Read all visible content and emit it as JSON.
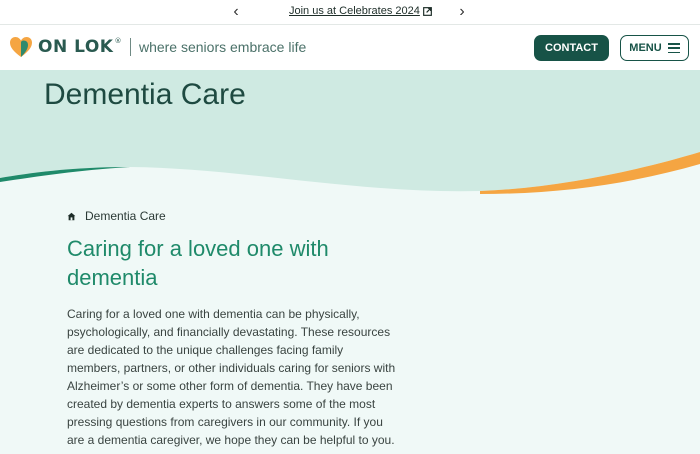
{
  "announcement": {
    "link_text": "Join us at Celebrates 2024",
    "prev_icon": "chevron-left-icon",
    "next_icon": "chevron-right-icon"
  },
  "header": {
    "brand": "ON LOK",
    "trademark": "®",
    "tagline": "where seniors embrace life",
    "contact_label": "CONTACT",
    "menu_label": "MENU"
  },
  "hero": {
    "title": "Dementia Care"
  },
  "breadcrumb": {
    "current": "Dementia Care"
  },
  "main": {
    "heading": "Caring for a loved one with dementia",
    "paragraph": "Caring for a loved one with dementia can be physically, psychologically, and financially devastating. These resources are dedicated to the unique challenges facing family members, partners, or other individuals caring for seniors with Alzheimer’s or some other form of dementia. They have been created by dementia experts to answers some of the most pressing questions from caregivers in our community. If you are a dementia caregiver, we hope they can be helpful to you."
  },
  "colors": {
    "brand_green": "#175347",
    "accent_green": "#1f8a6a",
    "hero_mint": "#cfeae2",
    "accent_orange": "#f5a542"
  }
}
